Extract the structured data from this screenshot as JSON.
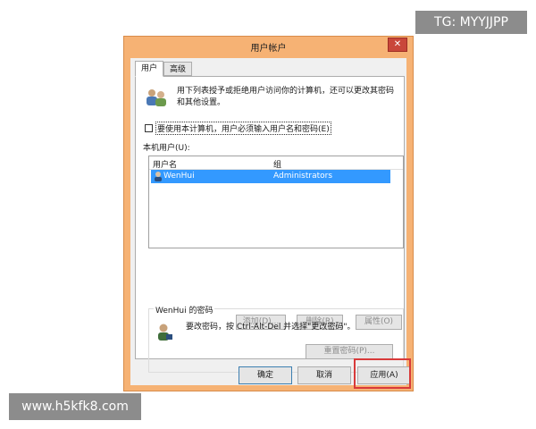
{
  "watermarks": {
    "top": "TG: MYYJJPP",
    "bottom": "www.h5kfk8.com"
  },
  "window": {
    "title": "用户帐户",
    "close_glyph": "✕"
  },
  "tabs": [
    {
      "label": "用户",
      "active": true
    },
    {
      "label": "高级",
      "active": false
    }
  ],
  "users_tab": {
    "description": "用下列表授予或拒绝用户访问你的计算机，还可以更改其密码和其他设置。",
    "require_login_checkbox": {
      "label": "要使用本计算机，用户必须输入用户名和密码(E)",
      "checked": false
    },
    "local_users_label": "本机用户(U):",
    "table": {
      "columns": [
        "用户名",
        "组"
      ],
      "rows": [
        {
          "user": "WenHui",
          "group": "Administrators",
          "selected": true
        }
      ]
    },
    "buttons": {
      "add": "添加(D)...",
      "remove": "删除(R)",
      "properties": "属性(O)"
    },
    "password_group": {
      "title": "WenHui 的密码",
      "text": "要改密码，按 Ctrl-Alt-Del 并选择\"更改密码\"。",
      "reset_button": "重置密码(P)..."
    }
  },
  "footer": {
    "ok": "确定",
    "cancel": "取消",
    "apply": "应用(A)"
  },
  "colors": {
    "window_frame": "#f6b274",
    "selection": "#3399ff",
    "close": "#c9473a",
    "highlight": "#d83a3a"
  },
  "icons": {
    "users": "users-icon",
    "row": "user-row-icon",
    "password": "password-user-icon",
    "close": "close-icon"
  }
}
